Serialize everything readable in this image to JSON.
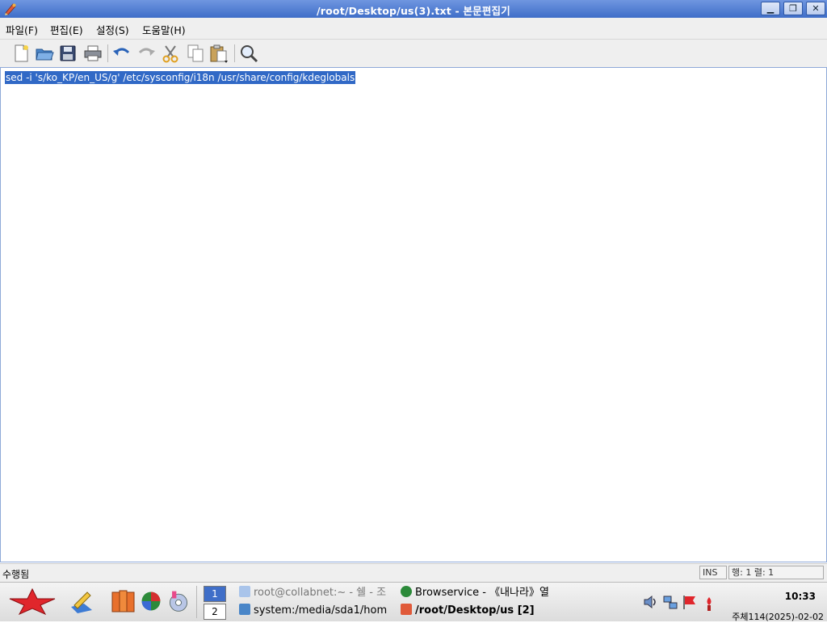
{
  "window": {
    "title": "/root/Desktop/us(3).txt - 본문편집기",
    "minimize_label": "▁",
    "maximize_label": "❐",
    "close_label": "✕"
  },
  "menu": [
    "파일(F)",
    "편집(E)",
    "설정(S)",
    "도움말(H)"
  ],
  "toolbar": {
    "icons": [
      "new-document-icon",
      "open-folder-icon",
      "save-icon",
      "print-icon",
      "undo-icon",
      "redo-icon",
      "cut-icon",
      "copy-icon",
      "paste-icon",
      "find-icon"
    ]
  },
  "editor": {
    "text": "sed -i 's/ko_KP/en_US/g' /etc/sysconfig/i18n /usr/share/config/kdeglobals",
    "selected": true
  },
  "status": {
    "message": "수행됨",
    "mode": "INS",
    "position": "행: 1 렬: 1"
  },
  "taskbar": {
    "pager": [
      "1",
      "2"
    ],
    "tasks": [
      "root@collabnet:~ - 쉘 - 조",
      "Browservice - 《내나라》열",
      "system:/media/sda1/hom",
      "/root/Desktop/us [2]"
    ],
    "clock": "10:33",
    "date": "주체114(2025)-02-02"
  },
  "colors": {
    "titlebar": "#3f6ec8",
    "selection": "#3169c6"
  }
}
